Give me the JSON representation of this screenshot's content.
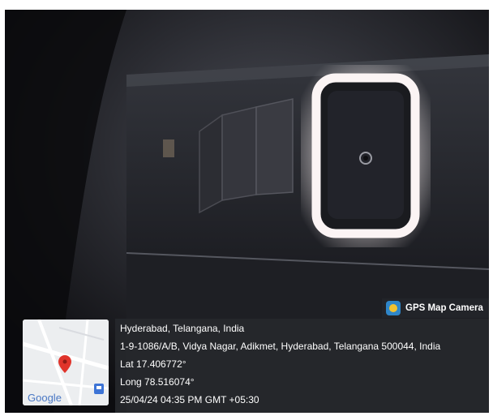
{
  "badge": {
    "label": "GPS Map Camera"
  },
  "location": {
    "line1": "Hyderabad, Telangana, India",
    "line2": "1-9-1086/A/B, Vidya Nagar, Adikmet, Hyderabad, Telangana 500044, India",
    "lat": "Lat 17.406772°",
    "long": "Long 78.516074°",
    "timestamp": "25/04/24 04:35 PM GMT +05:30"
  },
  "map": {
    "brand": "Google",
    "pin_color": "#e0342b"
  },
  "colors": {
    "ring_glow": "#f4eef0",
    "panel_bg": "#26282c"
  }
}
